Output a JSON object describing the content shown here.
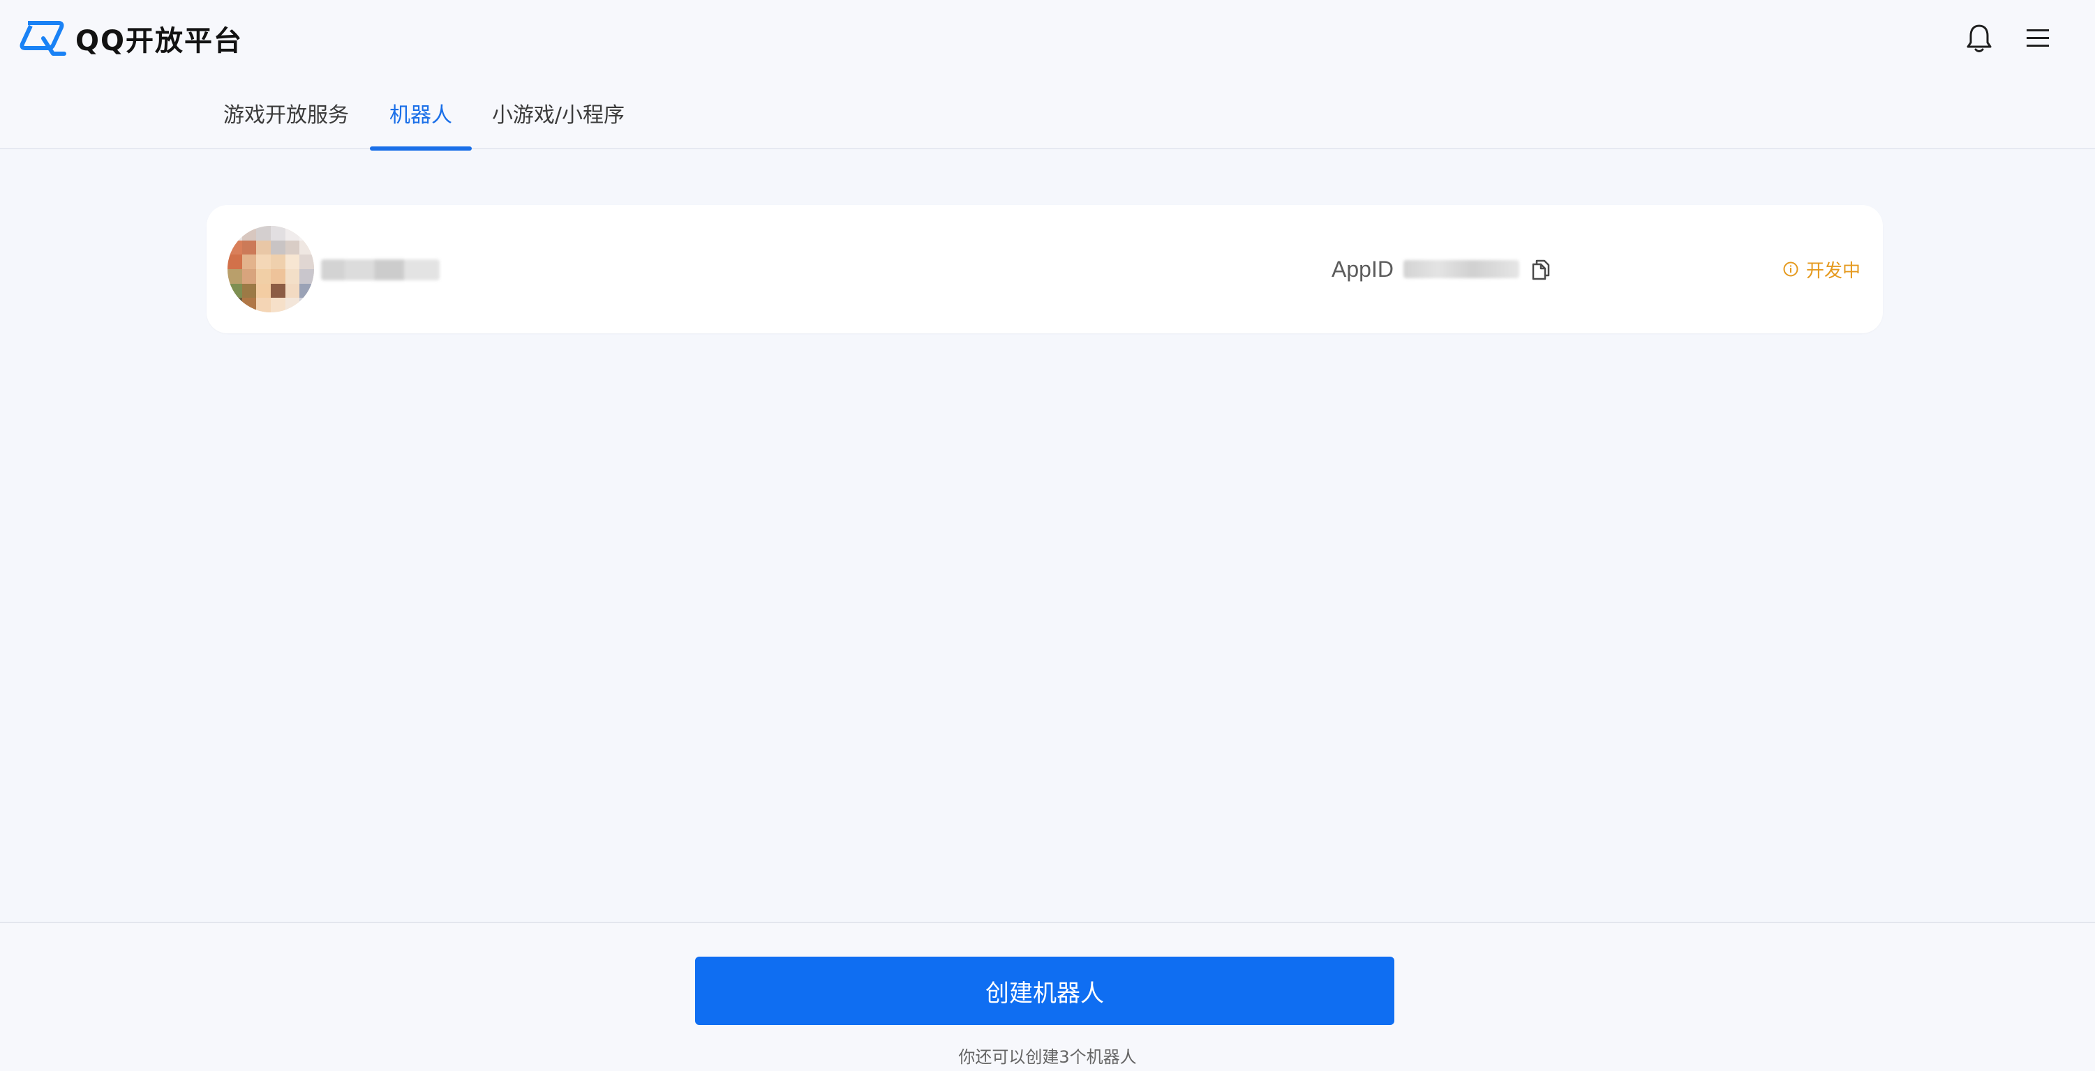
{
  "header": {
    "logo_text": "QQ开放平台",
    "logo_icon": "qq-open-platform-logo-icon",
    "actions": [
      {
        "name": "notification-bell-icon"
      },
      {
        "name": "menu-icon"
      }
    ],
    "colors": {
      "accent": "#1a6fe8",
      "logo_blue": "#1a82f5"
    }
  },
  "tabs": [
    {
      "label": "游戏开放服务",
      "active": false
    },
    {
      "label": "机器人",
      "active": true
    },
    {
      "label": "小游戏/小程序",
      "active": false
    }
  ],
  "bot_card": {
    "appid_label": "AppID",
    "copy_icon": "copy-icon",
    "status_label": "开发中",
    "status_icon": "info-circle-icon",
    "status_color": "#e59a1f"
  },
  "footer": {
    "create_button_label": "创建机器人",
    "remaining_text": "你还可以创建3个机器人",
    "button_color": "#0f6ef2"
  }
}
